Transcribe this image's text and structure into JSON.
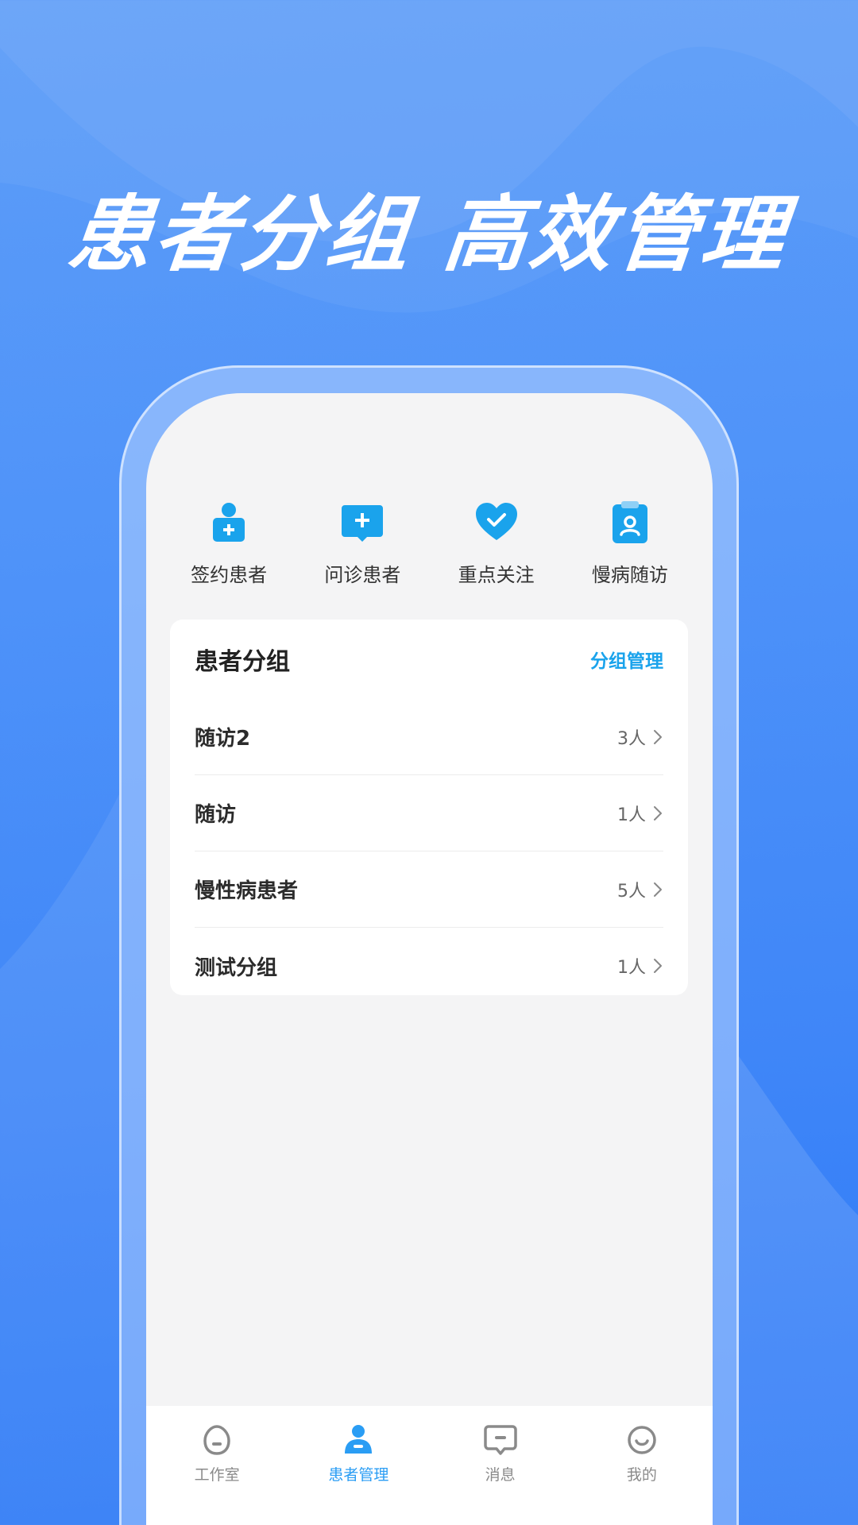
{
  "headline": "患者分组 高效管理",
  "colors": {
    "accent": "#1aa3ec",
    "tab_active": "#2a9df4",
    "tab_inactive": "#8a8a8a",
    "background": "#4f93f9"
  },
  "quick_actions": [
    {
      "label": "签约患者",
      "icon": "signed-patient-icon"
    },
    {
      "label": "问诊患者",
      "icon": "consult-patient-icon"
    },
    {
      "label": "重点关注",
      "icon": "heart-check-icon"
    },
    {
      "label": "慢病随访",
      "icon": "clipboard-user-icon"
    }
  ],
  "patient_groups": {
    "title": "患者分组",
    "manage_label": "分组管理",
    "items": [
      {
        "name": "随访2",
        "count": "3人"
      },
      {
        "name": "随访",
        "count": "1人"
      },
      {
        "name": "慢性病患者",
        "count": "5人"
      },
      {
        "name": "测试分组",
        "count": "1人"
      }
    ]
  },
  "tabs": [
    {
      "label": "工作室",
      "icon": "home-icon",
      "active": false
    },
    {
      "label": "患者管理",
      "icon": "patient-icon",
      "active": true
    },
    {
      "label": "消息",
      "icon": "message-icon",
      "active": false
    },
    {
      "label": "我的",
      "icon": "smile-icon",
      "active": false
    }
  ]
}
